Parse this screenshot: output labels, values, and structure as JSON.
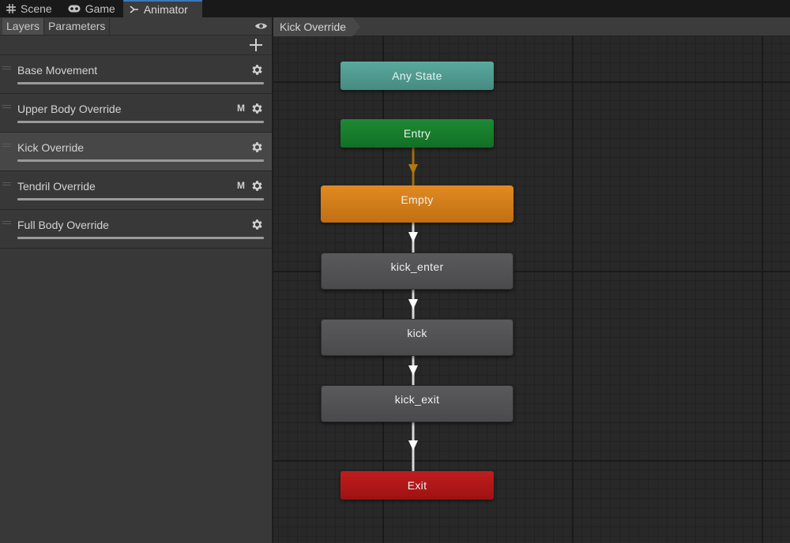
{
  "tabs": [
    {
      "label": "Scene",
      "icon": "grid-hash-icon"
    },
    {
      "label": "Game",
      "icon": "gamepad-icon"
    },
    {
      "label": "Animator",
      "icon": "animator-graph-icon",
      "active": true
    }
  ],
  "left_panel": {
    "subtabs": [
      {
        "label": "Layers",
        "active": true
      },
      {
        "label": "Parameters",
        "active": false
      }
    ],
    "layers": [
      {
        "name": "Base Movement",
        "flag": "",
        "selected": false
      },
      {
        "name": "Upper Body Override",
        "flag": "M",
        "selected": false
      },
      {
        "name": "Kick Override",
        "flag": "",
        "selected": true
      },
      {
        "name": "Tendril Override",
        "flag": "M",
        "selected": false
      },
      {
        "name": "Full Body Override",
        "flag": "",
        "selected": false
      }
    ]
  },
  "graph": {
    "breadcrumb": "Kick Override",
    "nodes": [
      {
        "label": "Any State",
        "kind": "any-state"
      },
      {
        "label": "Entry",
        "kind": "entry"
      },
      {
        "label": "Empty",
        "kind": "default-state"
      },
      {
        "label": "kick_enter",
        "kind": "state"
      },
      {
        "label": "kick",
        "kind": "state"
      },
      {
        "label": "kick_exit",
        "kind": "state"
      },
      {
        "label": "Exit",
        "kind": "exit"
      }
    ]
  },
  "colors": {
    "accent_tab": "#3a79bb",
    "any_state": "#4e9a90",
    "entry": "#187d2e",
    "default_state": "#d07d1a",
    "state": "#525254",
    "exit": "#b01818",
    "entry_transition": "#b07a10",
    "transition": "#ffffff"
  }
}
